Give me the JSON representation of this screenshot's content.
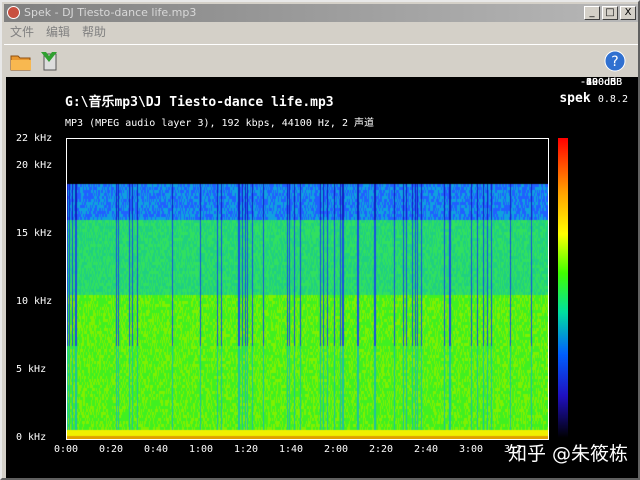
{
  "window": {
    "title": "Spek - DJ Tiesto-dance life.mp3",
    "min": "_",
    "max": "□",
    "close": "X"
  },
  "menu": [
    "文件",
    "编辑",
    "帮助"
  ],
  "toolbar": {
    "open_icon": "folder-open-icon",
    "save_icon": "save-icon",
    "help_icon": "help-icon"
  },
  "header": {
    "file": "G:\\音乐mp3\\DJ Tiesto-dance life.mp3",
    "info": "MP3 (MPEG audio layer 3), 192 kbps, 44100 Hz, 2 声道",
    "app": "spek",
    "version": "0.8.2"
  },
  "freq_ticks": [
    {
      "label": "22 kHz",
      "khz": 22
    },
    {
      "label": "20 kHz",
      "khz": 20
    },
    {
      "label": "15 kHz",
      "khz": 15
    },
    {
      "label": "10 kHz",
      "khz": 10
    },
    {
      "label": "5 kHz",
      "khz": 5
    },
    {
      "label": "0 kHz",
      "khz": 0
    }
  ],
  "time_ticks": [
    {
      "label": "0:00",
      "s": 0
    },
    {
      "label": "0:20",
      "s": 20
    },
    {
      "label": "0:40",
      "s": 40
    },
    {
      "label": "1:00",
      "s": 60
    },
    {
      "label": "1:20",
      "s": 80
    },
    {
      "label": "1:40",
      "s": 100
    },
    {
      "label": "2:00",
      "s": 120
    },
    {
      "label": "2:20",
      "s": 140
    },
    {
      "label": "2:40",
      "s": 160
    },
    {
      "label": "3:00",
      "s": 180
    },
    {
      "label": "3:2",
      "s": 200
    }
  ],
  "db_ticks": [
    {
      "label": "-20 dB",
      "db": -20
    },
    {
      "label": "-40 dB",
      "db": -40
    },
    {
      "label": "-60 dB",
      "db": -60
    },
    {
      "label": "-80 dB",
      "db": -80
    },
    {
      "label": "-100 dB",
      "db": -100
    },
    {
      "label": "-120 dB",
      "db": -120
    }
  ],
  "watermark": "知乎 @朱筱栋",
  "colors": {
    "accent": "#ff0000"
  }
}
